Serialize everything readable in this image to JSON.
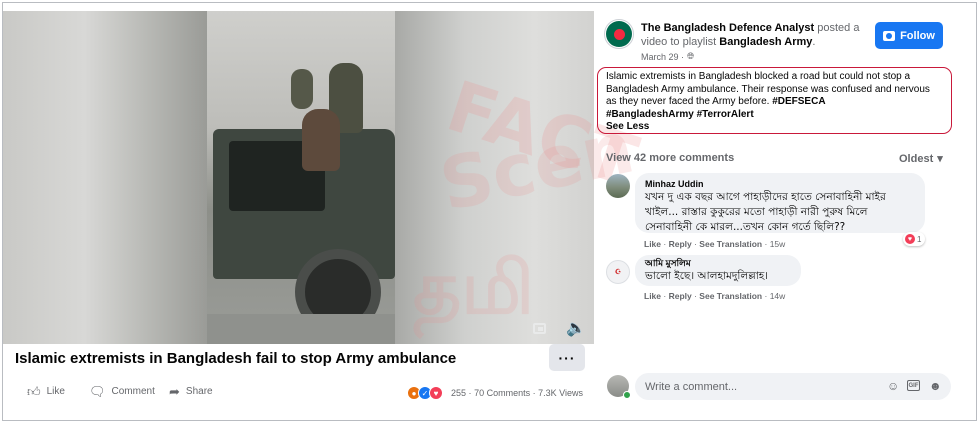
{
  "video": {
    "title": "Islamic extremists in Bangladesh fail to stop Army ambulance",
    "more_label": "···",
    "pip_icon": "picture-in-picture-icon",
    "volume_icon": "speaker-muted-icon"
  },
  "watermark": {
    "lines": [
      "FACT",
      "Scen",
      "தமி"
    ]
  },
  "actions": {
    "like_label": "Like",
    "comment_label": "Comment",
    "share_label": "Share",
    "reaction_icons": [
      "angry-icon",
      "like-icon",
      "love-icon"
    ],
    "reaction_count": "255",
    "comments_count": "70 Comments",
    "views_count": "7.3K Views",
    "separator": "·"
  },
  "post": {
    "page_name": "The Bangladesh Defence Analyst",
    "posted_text": " posted a video to playlist ",
    "playlist": "Bangladesh Army",
    "playlist_suffix": ".",
    "date": "March 29 ·",
    "follow_label": "Follow",
    "caption": "Islamic extremists in Bangladesh blocked a road but could not stop a Bangladesh Army ambulance. Their response was confused and nervous as they never faced the Army before. ",
    "hashtags": [
      "#DEFSECA",
      "#BangladeshArmy",
      "#TerrorAlert"
    ],
    "see_less": "See Less"
  },
  "comments_header": {
    "view_more": "View 42 more comments",
    "sort": "Oldest",
    "sort_icon": "caret-down-icon"
  },
  "comments": [
    {
      "author": "Minhaz Uddin",
      "text": "যখন দু এক বছর আগে পাহাড়ীদের হাতে সেনাবাহিনী মাইর খাইল... রাস্তার কুকুরের মতো পাহাড়ী নারী পুরুষ মিলে সেনাবাহিনী কে মারল...তখন কোন গর্তে ছিলি??",
      "like": "Like",
      "reply": "Reply",
      "see_translation": "See Translation",
      "time": "15w",
      "reaction_count": "1",
      "sep": " · "
    },
    {
      "author": "আমি মুসলিম",
      "text": "ভালো ইছে। আলহামদুলিল্লাহ।",
      "like": "Like",
      "reply": "Reply",
      "see_translation": "See Translation",
      "time": "14w",
      "sep": " · "
    }
  ],
  "composer": {
    "placeholder": "Write a comment...",
    "icons": [
      "emoji-icon",
      "gif-icon",
      "sticker-icon"
    ]
  },
  "colors": {
    "follow_blue": "#1877f2",
    "caption_border": "#c9193a",
    "flag_green": "#006a4e",
    "flag_red": "#f42a41"
  }
}
